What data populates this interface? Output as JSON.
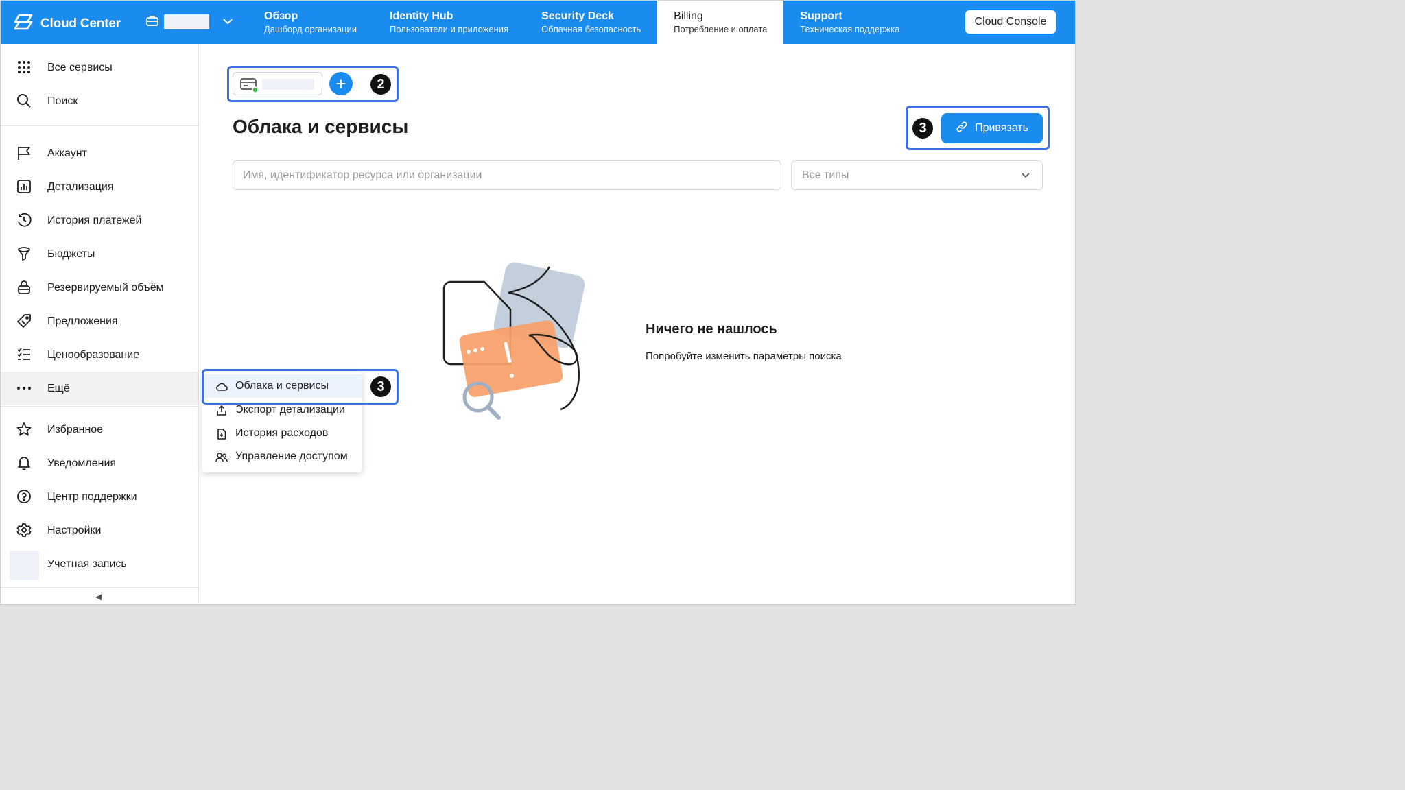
{
  "app": {
    "name": "Cloud Center",
    "logo_icon": "cloud-center-logo-icon"
  },
  "topnav": {
    "tabs": [
      {
        "title": "Обзор",
        "subtitle": "Дашборд организации"
      },
      {
        "title": "Identity Hub",
        "subtitle": "Пользователи и приложения"
      },
      {
        "title": "Security Deck",
        "subtitle": "Облачная безопасность"
      },
      {
        "title": "Billing",
        "subtitle": "Потребление и оплата",
        "active": true
      },
      {
        "title": "Support",
        "subtitle": "Техническая поддержка"
      }
    ],
    "console_button": "Cloud Console"
  },
  "sidebar": {
    "top_items": [
      {
        "label": "Все сервисы",
        "icon": "grid-icon"
      },
      {
        "label": "Поиск",
        "icon": "search-icon"
      }
    ],
    "items": [
      {
        "label": "Аккаунт",
        "icon": "flag-icon"
      },
      {
        "label": "Детализация",
        "icon": "chart-icon"
      },
      {
        "label": "История платежей",
        "icon": "history-icon"
      },
      {
        "label": "Бюджеты",
        "icon": "budget-icon"
      },
      {
        "label": "Резервируемый объём",
        "icon": "lock-icon"
      },
      {
        "label": "Предложения",
        "icon": "offers-icon"
      },
      {
        "label": "Ценообразование",
        "icon": "pricing-list-icon"
      },
      {
        "label": "Ещё",
        "icon": "more-icon"
      }
    ],
    "bottom_items": [
      {
        "label": "Избранное",
        "icon": "star-icon"
      },
      {
        "label": "Уведомления",
        "icon": "bell-icon"
      },
      {
        "label": "Центр поддержки",
        "icon": "help-icon"
      },
      {
        "label": "Настройки",
        "icon": "gear-icon"
      },
      {
        "label": "Учётная запись",
        "icon": "avatar"
      }
    ],
    "collapse_glyph": "◀"
  },
  "main": {
    "title": "Облака и сервисы",
    "add_symbol": "+",
    "link_button": "Привязать",
    "search_placeholder": "Имя, идентификатор ресурса или организации",
    "type_select_value": "Все типы",
    "empty": {
      "title": "Ничего не нашлось",
      "subtitle": "Попробуйте изменить параметры поиска"
    }
  },
  "popup_menu": {
    "items": [
      {
        "label": "Облака и сервисы",
        "icon": "cloud-icon",
        "selected": true
      },
      {
        "label": "Экспорт детализации",
        "icon": "export-icon"
      },
      {
        "label": "История расходов",
        "icon": "download-file-icon"
      },
      {
        "label": "Управление доступом",
        "icon": "users-icon"
      }
    ]
  },
  "annotations": {
    "badge_account": "2",
    "badge_link": "3",
    "badge_menu": "3"
  },
  "colors": {
    "accent": "#1a8cf0",
    "highlight_border": "#3d6fe0",
    "badge": "#111111",
    "illustration_orange": "#f7a06b",
    "illustration_blue": "#c3cfdd"
  }
}
